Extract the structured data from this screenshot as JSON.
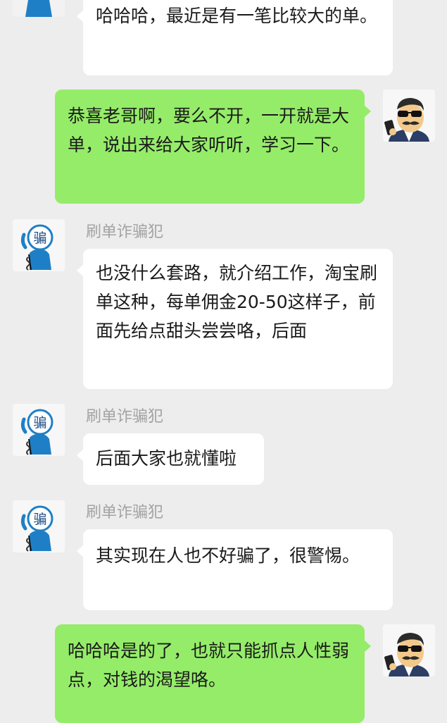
{
  "chat": {
    "messages": [
      {
        "side": "left",
        "sender": "",
        "text": "哈哈哈，最近是有一笔比较大的单。"
      },
      {
        "side": "right",
        "sender": "",
        "text": "恭喜老哥啊，要么不开，一开就是大单，说出来给大家听听，学习一下。"
      },
      {
        "side": "left",
        "sender": "刷单诈骗犯",
        "text": "也没什么套路，就介绍工作，淘宝刷单这种，每单佣金20-50这样子，前面先给点甜头尝尝咯，后面"
      },
      {
        "side": "left",
        "sender": "刷单诈骗犯",
        "text": "后面大家也就懂啦"
      },
      {
        "side": "left",
        "sender": "刷单诈骗犯",
        "text": "其实现在人也不好骗了，很警惕。"
      },
      {
        "side": "right",
        "sender": "",
        "text": "哈哈哈是的了，也就只能抓点人性弱点，对钱的渴望咯。"
      }
    ]
  },
  "avatars": {
    "scammer_glyph": "骗",
    "scammer_icon": "scammer-phone-avatar-icon",
    "user_icon": "sunglasses-mustache-avatar-icon"
  },
  "colors": {
    "background": "#ededed",
    "incoming_bubble": "#ffffff",
    "outgoing_bubble": "#95ec69",
    "sender_name": "#a3a3a3",
    "scammer_avatar_blue": "#1f7fc6"
  }
}
